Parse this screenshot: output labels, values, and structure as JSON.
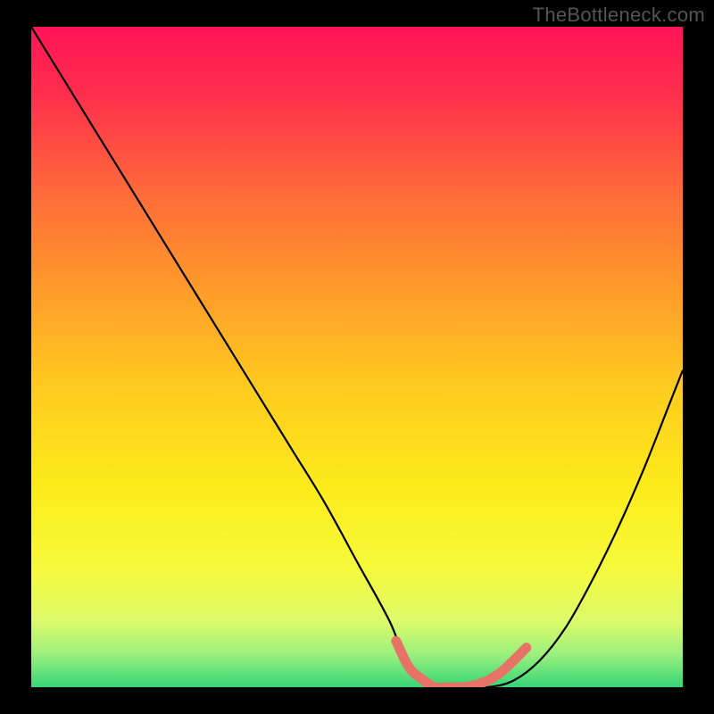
{
  "watermark": "TheBottleneck.com",
  "chart_data": {
    "type": "line",
    "title": "",
    "xlabel": "",
    "ylabel": "",
    "xlim": [
      0,
      100
    ],
    "ylim": [
      0,
      100
    ],
    "grid": false,
    "legend": false,
    "series": [
      {
        "name": "curve",
        "color": "#000000",
        "x": [
          0,
          5,
          10,
          15,
          20,
          25,
          30,
          35,
          40,
          45,
          50,
          55,
          58,
          62,
          66,
          70,
          74,
          78,
          82,
          86,
          90,
          94,
          98,
          100
        ],
        "values": [
          100,
          92,
          84,
          76,
          68,
          60,
          52,
          44,
          36,
          28,
          19,
          10,
          3,
          0,
          0,
          0,
          1,
          4,
          9,
          16,
          24,
          33,
          43,
          48
        ]
      },
      {
        "name": "valley-highlight",
        "color": "#E77367",
        "x": [
          56,
          58,
          60,
          62,
          64,
          66,
          68,
          70,
          72,
          74,
          76
        ],
        "values": [
          7,
          3,
          1.2,
          0,
          0,
          0,
          0.3,
          1,
          2.2,
          4,
          6
        ]
      }
    ],
    "background_gradient": {
      "stops": [
        {
          "offset": 0.0,
          "color": "#FF1457"
        },
        {
          "offset": 0.1,
          "color": "#FF2E4C"
        },
        {
          "offset": 0.25,
          "color": "#FF6A3A"
        },
        {
          "offset": 0.4,
          "color": "#FF9C2A"
        },
        {
          "offset": 0.55,
          "color": "#FFCC1F"
        },
        {
          "offset": 0.7,
          "color": "#FCEC1B"
        },
        {
          "offset": 0.82,
          "color": "#F6FA3C"
        },
        {
          "offset": 0.9,
          "color": "#DCFA6A"
        },
        {
          "offset": 0.95,
          "color": "#9CF07E"
        },
        {
          "offset": 1.0,
          "color": "#36D576"
        }
      ]
    }
  }
}
